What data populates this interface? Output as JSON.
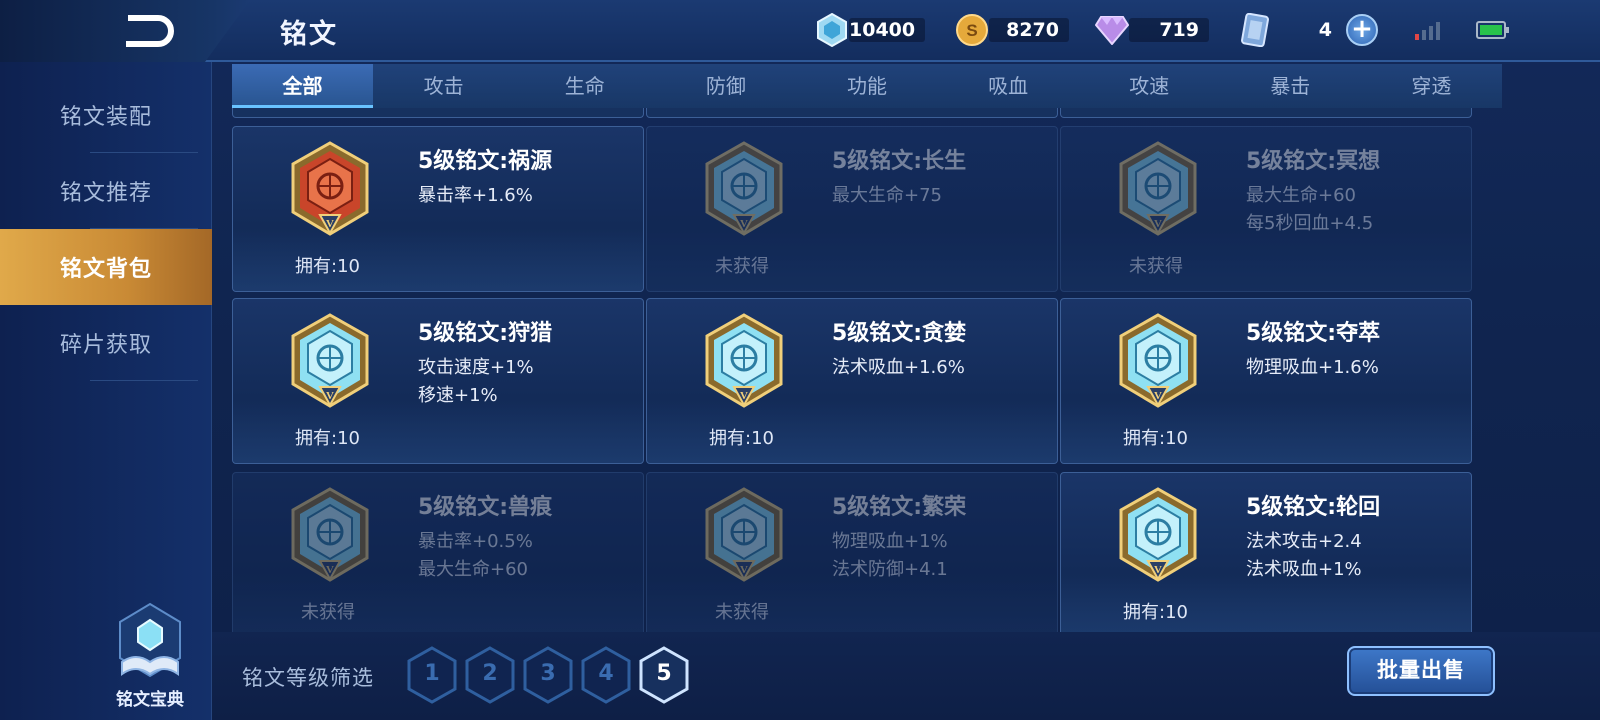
{
  "header": {
    "title": "铭文",
    "currencies": [
      {
        "icon": "crystal-icon",
        "value": "10400"
      },
      {
        "icon": "gold-coin-icon",
        "value": "8270"
      },
      {
        "icon": "diamond-icon",
        "value": "719"
      },
      {
        "icon": "card-ticket-icon",
        "value": "4"
      }
    ]
  },
  "sidebar": {
    "items": [
      {
        "label": "铭文装配"
      },
      {
        "label": "铭文推荐"
      },
      {
        "label": "铭文背包",
        "active": true
      },
      {
        "label": "碎片获取"
      }
    ],
    "codex_label": "铭文宝典"
  },
  "tabs": [
    "全部",
    "攻击",
    "生命",
    "防御",
    "功能",
    "吸血",
    "攻速",
    "暴击",
    "穿透"
  ],
  "active_tab": "全部",
  "runes": [
    {
      "name": "5级铭文:祸源",
      "stats": [
        "暴击率+1.6%"
      ],
      "own": "拥有:10",
      "locked": false,
      "theme": "red"
    },
    {
      "name": "5级铭文:长生",
      "stats": [
        "最大生命+75"
      ],
      "own": "未获得",
      "locked": true,
      "theme": "blue"
    },
    {
      "name": "5级铭文:冥想",
      "stats": [
        "最大生命+60",
        "每5秒回血+4.5"
      ],
      "own": "未获得",
      "locked": true,
      "theme": "blue"
    },
    {
      "name": "5级铭文:狩猎",
      "stats": [
        "攻击速度+1%",
        "移速+1%"
      ],
      "own": "拥有:10",
      "locked": false,
      "theme": "blue"
    },
    {
      "name": "5级铭文:贪婪",
      "stats": [
        "法术吸血+1.6%"
      ],
      "own": "拥有:10",
      "locked": false,
      "theme": "blue"
    },
    {
      "name": "5级铭文:夺萃",
      "stats": [
        "物理吸血+1.6%"
      ],
      "own": "拥有:10",
      "locked": false,
      "theme": "blue"
    },
    {
      "name": "5级铭文:兽痕",
      "stats": [
        "暴击率+0.5%",
        "最大生命+60"
      ],
      "own": "未获得",
      "locked": true,
      "theme": "blue"
    },
    {
      "name": "5级铭文:繁荣",
      "stats": [
        "物理吸血+1%",
        "法术防御+4.1"
      ],
      "own": "未获得",
      "locked": true,
      "theme": "blue"
    },
    {
      "name": "5级铭文:轮回",
      "stats": [
        "法术攻击+2.4",
        "法术吸血+1%"
      ],
      "own": "拥有:10",
      "locked": false,
      "theme": "blue"
    }
  ],
  "emblem_mark": "V",
  "filter": {
    "label": "铭文等级筛选",
    "levels": [
      "1",
      "2",
      "3",
      "4",
      "5"
    ],
    "selected": "5"
  },
  "sell_label": "批量出售",
  "colors": {
    "accent_gold": "#d9a046",
    "emblem_red": "#c9452a",
    "emblem_blue": "#8fe0f2",
    "tab_active": "#3b6bb5"
  }
}
